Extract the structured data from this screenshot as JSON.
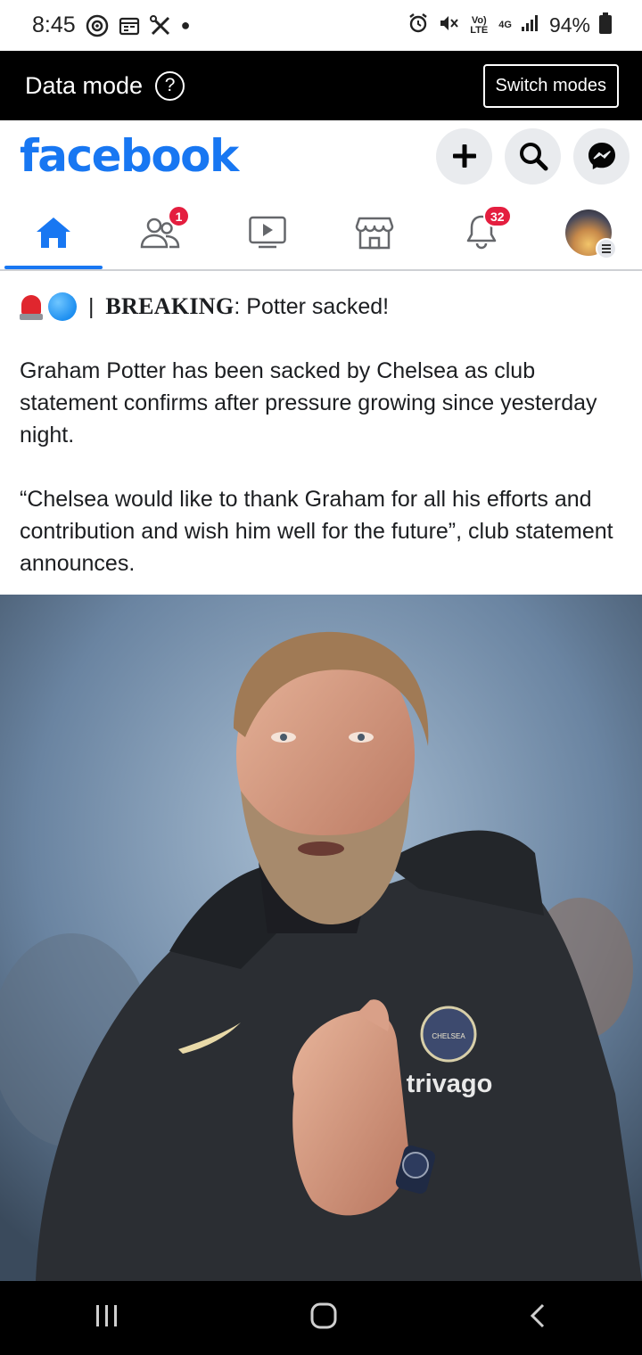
{
  "status_bar": {
    "time": "8:45",
    "volte": "Vo) LTE",
    "network": "4G",
    "battery": "94%"
  },
  "data_mode_bar": {
    "title": "Data mode",
    "help": "?",
    "switch_label": "Switch modes"
  },
  "header": {
    "logo": "facebook",
    "brand_color": "#1877f2"
  },
  "nav": {
    "friends_badge": "1",
    "notifications_badge": "32"
  },
  "post": {
    "headline_sep": " | ",
    "headline_bold": "BREAKING",
    "headline_rest": ": Potter sacked!",
    "paragraph_1": "Graham Potter has been sacked by Chelsea as club statement confirms after pressure growing since yesterday night.",
    "paragraph_2": "“Chelsea would like to thank Graham for all his efforts and contribution and wish him well for the future”, club statement announces."
  },
  "photo": {
    "shirt_sponsor": "trivago",
    "crest_text": "CHELSEA"
  }
}
